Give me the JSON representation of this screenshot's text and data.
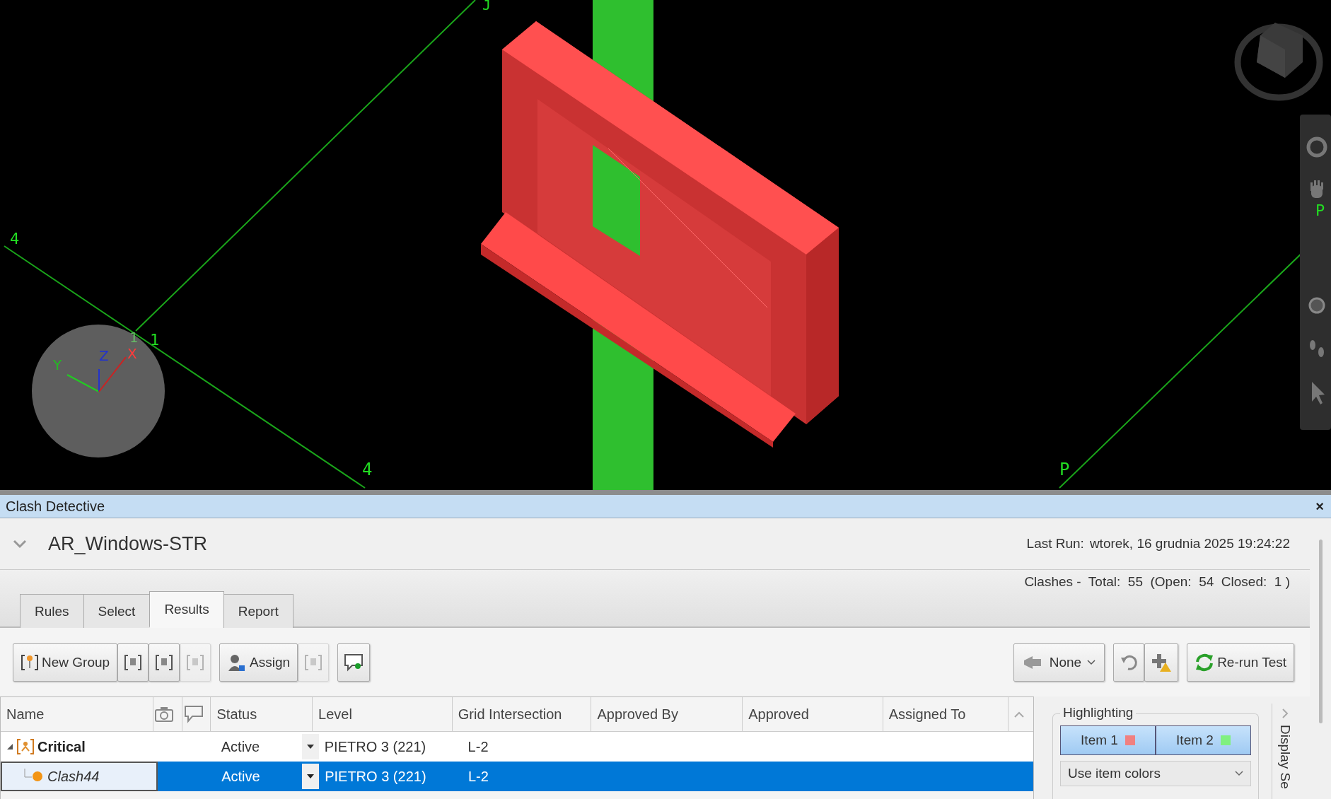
{
  "viewport": {
    "grid_labels": [
      "J",
      "4",
      "1",
      "1",
      "4",
      "P",
      "P"
    ],
    "axis_labels": [
      "X",
      "Y",
      "Z"
    ]
  },
  "panel": {
    "title": "Clash Detective",
    "close": "×"
  },
  "test": {
    "name": "AR_Windows-STR",
    "expanded": true,
    "last_run_label": "Last Run:",
    "last_run": "wtorek, 16 grudnia 2025 19:24:22",
    "summary": "Clashes -  Total:  55  (Open:  54  Closed:  1 )"
  },
  "tabs": [
    {
      "label": "Rules",
      "selected": false
    },
    {
      "label": "Select",
      "selected": false
    },
    {
      "label": "Results",
      "selected": true
    },
    {
      "label": "Report",
      "selected": false
    }
  ],
  "toolbar": {
    "left": [
      {
        "kind": "text",
        "label": "New Group",
        "disabled": false
      },
      {
        "kind": "icon",
        "disabled": false
      },
      {
        "kind": "icon",
        "disabled": false
      },
      {
        "kind": "icon",
        "disabled": true
      },
      {
        "kind": "text",
        "label": "Assign",
        "disabled": false
      },
      {
        "kind": "icon",
        "disabled": true
      },
      {
        "kind": "icon",
        "disabled": false
      }
    ],
    "filter": "None",
    "rerun": "Re-run Test"
  },
  "table": {
    "columns": [
      {
        "kind": "text",
        "label": "Name"
      },
      {
        "kind": "camera"
      },
      {
        "kind": "comment"
      },
      {
        "kind": "text",
        "label": "Status"
      },
      {
        "kind": "text",
        "label": "Level"
      },
      {
        "kind": "text",
        "label": "Grid Intersection"
      },
      {
        "kind": "text",
        "label": "Approved By"
      },
      {
        "kind": "text",
        "label": "Approved"
      },
      {
        "kind": "text",
        "label": "Assigned To"
      }
    ],
    "rows": [
      {
        "kind": "group",
        "name": "Critical",
        "expanded": true,
        "status": "Active",
        "level": "PIETRO 3 (221)",
        "grid": "L-2",
        "selected": false
      },
      {
        "kind": "clash",
        "name": "Clash44",
        "status": "Active",
        "level": "PIETRO 3 (221)",
        "grid": "L-2",
        "selected": true
      }
    ]
  },
  "highlighting": {
    "title": "Highlighting",
    "items": [
      {
        "label": "Item 1",
        "color": "#f08080",
        "selected": true
      },
      {
        "label": "Item 2",
        "color": "#80f080",
        "selected": true
      }
    ],
    "mode": "Use item colors"
  },
  "side_tab": "Display Se"
}
